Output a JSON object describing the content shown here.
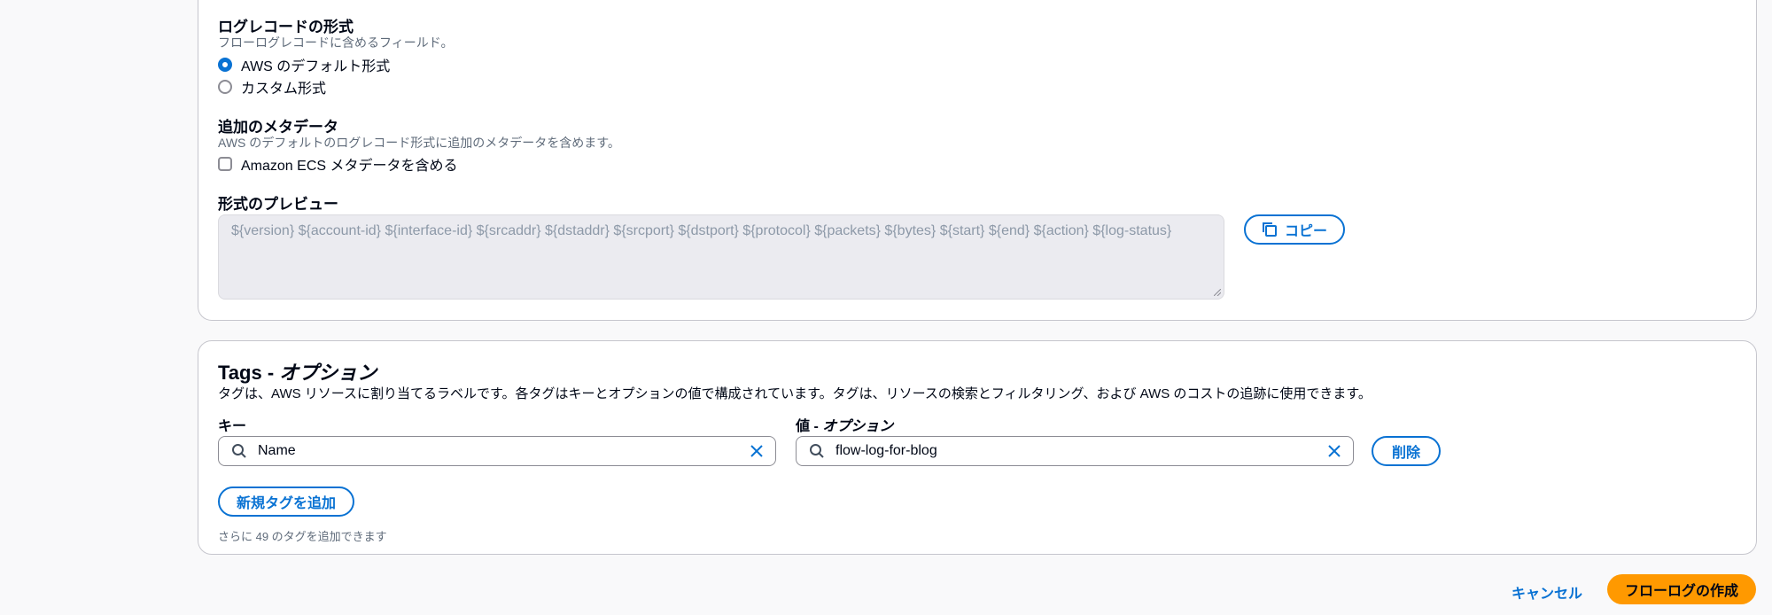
{
  "log_format": {
    "label": "ログレコードの形式",
    "description": "フローログレコードに含めるフィールド。",
    "options": [
      "AWS のデフォルト形式",
      "カスタム形式"
    ],
    "selected": 0
  },
  "metadata": {
    "label": "追加のメタデータ",
    "description": "AWS のデフォルトのログレコード形式に追加のメタデータを含めます。",
    "checkbox_label": "Amazon ECS メタデータを含める"
  },
  "preview": {
    "label": "形式のプレビュー",
    "text": "${version} ${account-id} ${interface-id} ${srcaddr} ${dstaddr} ${srcport} ${dstport} ${protocol} ${packets} ${bytes} ${start} ${end} ${action} ${log-status}",
    "copy_label": "コピー"
  },
  "tags": {
    "title_main": "Tags - ",
    "title_optional": "オプション",
    "description": "タグは、AWS リソースに割り当てるラベルです。各タグはキーとオプションの値で構成されています。タグは、リソースの検索とフィルタリング、および AWS のコストの追跡に使用できます。",
    "key_label": "キー",
    "value_label_main": "値 - ",
    "value_label_optional": "オプション",
    "key_value": "Name",
    "value_value": "flow-log-for-blog",
    "remove_label": "削除",
    "add_label": "新規タグを追加",
    "remaining_text": "さらに 49 のタグを追加できます"
  },
  "footer": {
    "cancel_label": "キャンセル",
    "create_label": "フローログの作成"
  },
  "colors": {
    "accent": "#0972d3",
    "primary": "#ff9900"
  }
}
